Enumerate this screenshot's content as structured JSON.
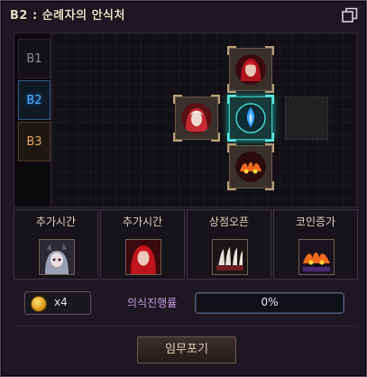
{
  "window": {
    "title": "B2 : 순례자의 안식처",
    "restore_icon": "window-restore-icon"
  },
  "floors": [
    {
      "label": "B1",
      "state": "inactive"
    },
    {
      "label": "B2",
      "state": "current"
    },
    {
      "label": "B3",
      "state": "locked"
    }
  ],
  "rooms": [
    {
      "name": "north-room",
      "icon": "red-haired-woman-portrait-icon",
      "state": "explored"
    },
    {
      "name": "west-room",
      "icon": "white-haired-warrior-portrait-icon",
      "state": "explored"
    },
    {
      "name": "center-room",
      "icon": "blue-flame-player-marker-icon",
      "state": "current"
    },
    {
      "name": "east-room",
      "icon": "",
      "state": "unexplored"
    },
    {
      "name": "south-room",
      "icon": "flame-eyes-icon",
      "state": "explored"
    }
  ],
  "buffs": [
    {
      "label": "추가시간",
      "icon": "horned-girl-portrait-icon"
    },
    {
      "label": "추가시간",
      "icon": "red-haired-woman-portrait-icon"
    },
    {
      "label": "상점오픈",
      "icon": "claw-beast-icon"
    },
    {
      "label": "코인증가",
      "icon": "flame-eyes-icon"
    }
  ],
  "coins": {
    "icon": "gold-coin-icon",
    "count": "x4"
  },
  "progress": {
    "label": "의식진행률",
    "text": "0%",
    "value": 0
  },
  "actions": {
    "abandon_label": "임무포기"
  },
  "colors": {
    "accent_current": "#3ec8c2",
    "floor_current": "#4fb3ff",
    "progress_label": "#c79ce6"
  }
}
